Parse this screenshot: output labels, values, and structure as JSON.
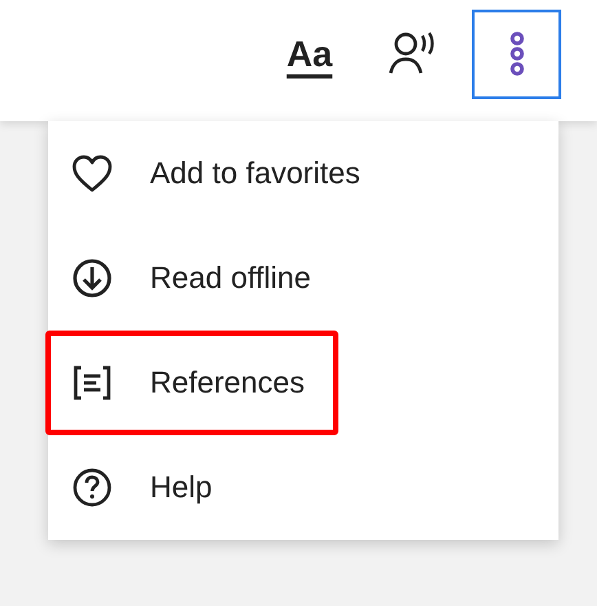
{
  "toolbar": {
    "buttons": [
      {
        "kind": "text-size",
        "label": "Aa",
        "focused": false
      },
      {
        "kind": "listen",
        "focused": false
      },
      {
        "kind": "more",
        "focused": true
      }
    ]
  },
  "menu": {
    "items": [
      {
        "kind": "heart",
        "label": "Add to favorites",
        "highlighted": false
      },
      {
        "kind": "download",
        "label": "Read offline",
        "highlighted": false
      },
      {
        "kind": "references",
        "label": "References",
        "highlighted": true
      },
      {
        "kind": "help",
        "label": "Help",
        "highlighted": false
      }
    ]
  }
}
